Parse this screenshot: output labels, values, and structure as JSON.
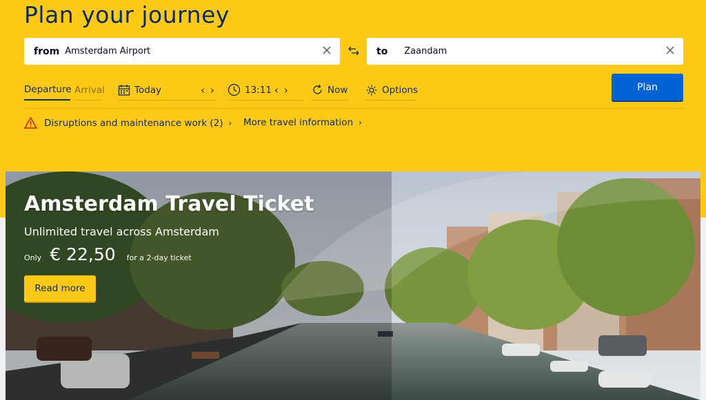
{
  "header": {
    "title": "Plan your journey"
  },
  "from": {
    "label": "from",
    "value": "Amsterdam Airport"
  },
  "to": {
    "label": "to",
    "value": "Zaandam"
  },
  "options": {
    "departure": "Departure",
    "arrival": "Arrival",
    "date": "Today",
    "time": "13:11",
    "now": "Now",
    "options": "Options",
    "plan": "Plan"
  },
  "links": {
    "disruptions": "Disruptions and maintenance work (2)",
    "more_info": "More travel information"
  },
  "hero": {
    "title": "Amsterdam Travel Ticket",
    "subtitle": "Unlimited travel across Amsterdam",
    "only": "Only",
    "price": "€ 22,50",
    "note": "for a 2-day ticket",
    "button": "Read more"
  },
  "icons": {
    "swap": "swap-arrows-icon",
    "calendar": "calendar-icon",
    "clock": "clock-icon",
    "refresh": "refresh-icon",
    "gear": "gear-icon",
    "warning": "warning-icon"
  },
  "colors": {
    "brand_yellow": "#ffc917",
    "brand_blue": "#0063d3",
    "text_navy": "#0e2a5a"
  }
}
